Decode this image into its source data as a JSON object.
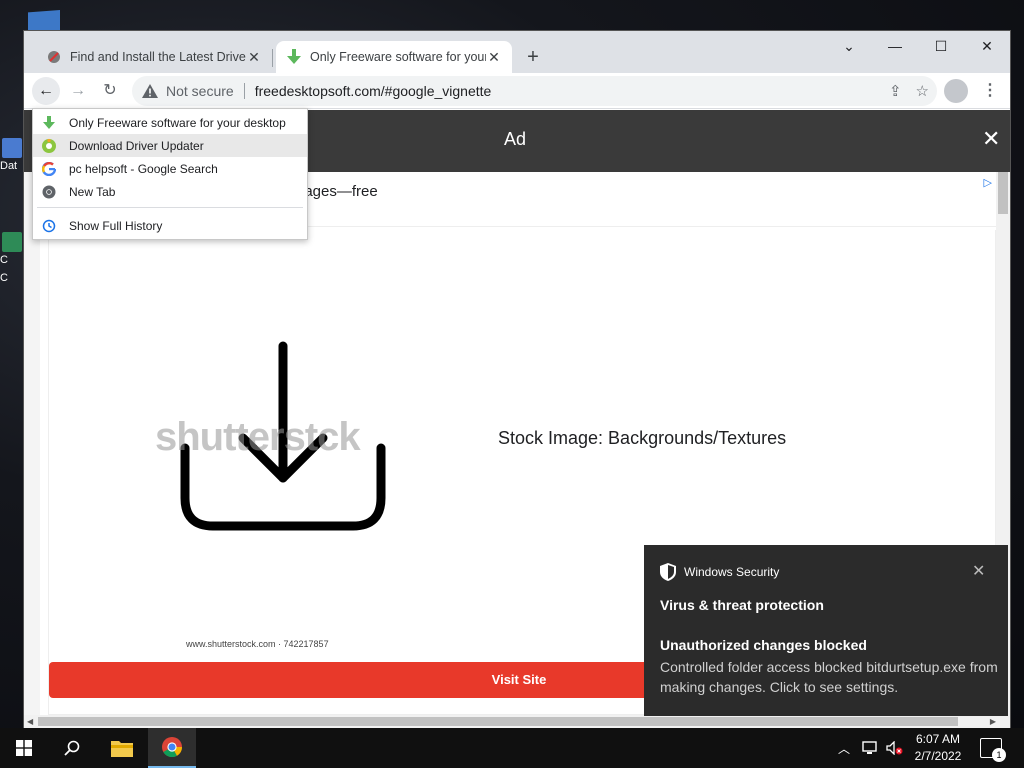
{
  "browser": {
    "tabs": [
      {
        "title": "Find and Install the Latest Drivers",
        "close": "✕",
        "favicon": "driver-tool-icon"
      },
      {
        "title": "Only Freeware software for your desktop",
        "close": "✕",
        "favicon": "green-download-icon"
      }
    ],
    "new_tab": "+",
    "window_controls": {
      "tab_search": "⌄",
      "minimize": "—",
      "maximize": "☐",
      "close": "✕"
    },
    "toolbar": {
      "back": "←",
      "forward": "→",
      "reload": "↻",
      "security_label": "Not secure",
      "url": "freedesktopsoft.com/#google_vignette",
      "menu": "⋮"
    }
  },
  "history_menu": {
    "items": [
      {
        "label": "Only Freeware software for your desktop",
        "icon": "green-download-icon"
      },
      {
        "label": "Download Driver Updater",
        "icon": "driver-updater-icon"
      },
      {
        "label": "pc helpsoft - Google Search",
        "icon": "google-icon"
      },
      {
        "label": "New Tab",
        "icon": "chrome-icon"
      }
    ],
    "show_full_history": "Show Full History"
  },
  "page": {
    "ad_label": "Ad",
    "ad_close": "✕",
    "ad_headline": "nages—free",
    "ad_choices": "▷",
    "watermark": "shutterstck",
    "stock_caption": "Stock Image: Backgrounds/Textures",
    "source": "www.shutterstock.com · 742217857",
    "visit_site": "Visit Site"
  },
  "toast": {
    "app": "Windows Security",
    "close": "✕",
    "heading": "Virus & threat protection",
    "subheading": "Unauthorized changes blocked",
    "body": "Controlled folder access blocked bitdurtsetup.exe from making changes. Click to see settings."
  },
  "desktop": {
    "icon_labels": [
      "Dat",
      "C",
      "C"
    ]
  },
  "taskbar": {
    "time": "6:07 AM",
    "date": "2/7/2022",
    "notification_count": "1"
  },
  "colors": {
    "visit_button": "#e8392a",
    "ad_bar": "#3a3a3a",
    "toast_bg": "#2b2b2b",
    "tabstrip": "#dee1e6"
  }
}
